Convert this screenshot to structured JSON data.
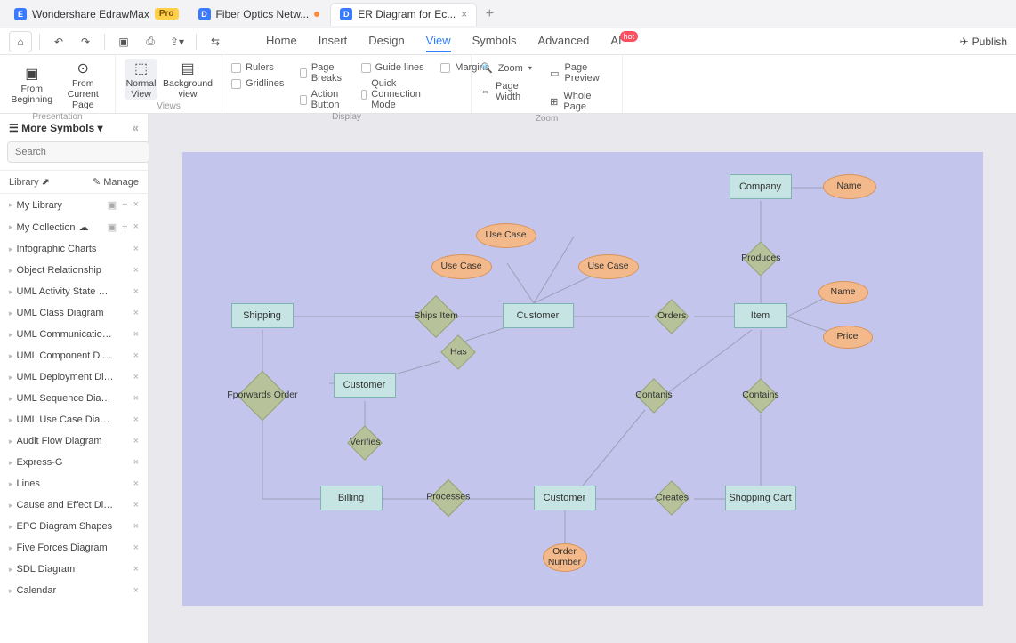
{
  "title_bar": {
    "app_name": "Wondershare EdrawMax",
    "pro_label": "Pro",
    "tabs": [
      {
        "label": "Fiber Optics Netw...",
        "dirty": true
      },
      {
        "label": "ER Diagram for Ec...",
        "active": true
      }
    ]
  },
  "toolbar": {
    "menu": [
      "Home",
      "Insert",
      "Design",
      "View",
      "Symbols",
      "Advanced"
    ],
    "active_menu": "View",
    "ai_label": "AI",
    "ai_badge": "hot",
    "publish": "Publish"
  },
  "ribbon": {
    "presentation": {
      "label": "Presentation",
      "from_beginning": "From Beginning",
      "from_current": "From Current Page"
    },
    "views": {
      "label": "Views",
      "normal": "Normal View",
      "background": "Background view"
    },
    "display": {
      "label": "Display",
      "col1": [
        "Rulers",
        "Gridlines"
      ],
      "col2": [
        "Page Breaks",
        "Action Button"
      ],
      "col3": [
        "Guide lines",
        "Quick Connection Mode"
      ],
      "col4": [
        "Margins"
      ]
    },
    "zoom": {
      "label": "Zoom",
      "zoom": "Zoom",
      "page_width": "Page Width",
      "page_preview": "Page Preview",
      "whole_page": "Whole Page"
    }
  },
  "sidebar": {
    "title": "More Symbols",
    "search_placeholder": "Search",
    "search_btn": "Search",
    "library_label": "Library",
    "manage_label": "Manage",
    "items": [
      {
        "label": "My Library",
        "actions": [
          "folder",
          "plus",
          "close"
        ]
      },
      {
        "label": "My Collection",
        "actions": [
          "folder",
          "plus",
          "close"
        ],
        "cloud": true
      },
      {
        "label": "Infographic Charts",
        "actions": [
          "close"
        ]
      },
      {
        "label": "Object Relationship",
        "actions": [
          "close"
        ]
      },
      {
        "label": "UML Activity State Diagram",
        "actions": [
          "close"
        ]
      },
      {
        "label": "UML Class Diagram",
        "actions": [
          "close"
        ]
      },
      {
        "label": "UML Communication Diagr...",
        "actions": [
          "close"
        ]
      },
      {
        "label": "UML Component Diagram",
        "actions": [
          "close"
        ]
      },
      {
        "label": "UML Deployment Diagram",
        "actions": [
          "close"
        ]
      },
      {
        "label": "UML Sequence Diagram",
        "actions": [
          "close"
        ]
      },
      {
        "label": "UML Use Case Diagram",
        "actions": [
          "close"
        ]
      },
      {
        "label": "Audit Flow Diagram",
        "actions": [
          "close"
        ]
      },
      {
        "label": "Express-G",
        "actions": [
          "close"
        ]
      },
      {
        "label": "Lines",
        "actions": [
          "close"
        ]
      },
      {
        "label": "Cause and Effect Diagram",
        "actions": [
          "close"
        ]
      },
      {
        "label": "EPC Diagram Shapes",
        "actions": [
          "close"
        ]
      },
      {
        "label": "Five Forces Diagram",
        "actions": [
          "close"
        ]
      },
      {
        "label": "SDL Diagram",
        "actions": [
          "close"
        ]
      },
      {
        "label": "Calendar",
        "actions": [
          "close"
        ]
      }
    ]
  },
  "diagram": {
    "entities": {
      "company": "Company",
      "item": "Item",
      "shipping": "Shipping",
      "customer1": "Customer",
      "customer2": "Customer",
      "customer3": "Customer",
      "billing": "Billing",
      "shopping_cart": "Shopping Cart"
    },
    "attributes": {
      "name_company": "Name",
      "name_item": "Name",
      "price": "Price",
      "use_case1": "Use Case",
      "use_case2": "Use Case",
      "use_case3": "Use Case",
      "order_number": "Order Number"
    },
    "relationships": {
      "produces": "Produces",
      "orders": "Orders",
      "ships_item": "Ships Item",
      "has": "Has",
      "forwards": "Fporwards Order",
      "verifies": "Verifies",
      "contanis": "Contanis",
      "contains": "Contains",
      "processes": "Processes",
      "creates": "Creates"
    }
  }
}
